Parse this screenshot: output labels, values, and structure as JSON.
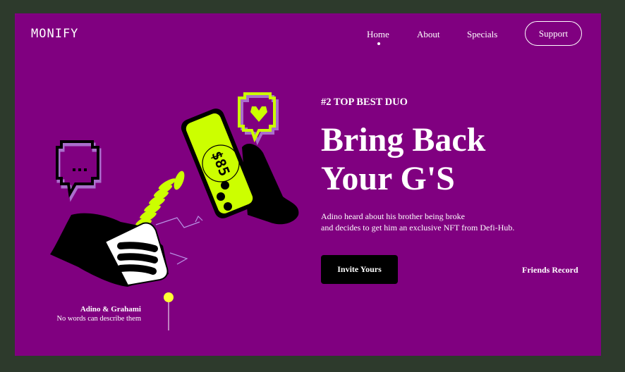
{
  "brand": {
    "logo": "MONIFY"
  },
  "nav": {
    "items": [
      {
        "label": "Home",
        "active": true
      },
      {
        "label": "About"
      },
      {
        "label": "Specials"
      }
    ],
    "support_label": "Support"
  },
  "hero": {
    "eyebrow": "#2 TOP BEST DUO",
    "headline_line1": "Bring Back",
    "headline_line2": "Your G'S",
    "description_line1": "Adino heard about his brother being broke",
    "description_line2": "and decides to get him an exclusive NFT from Defi-Hub.",
    "cta_label": "Invite Yours",
    "secondary_link": "Friends Record"
  },
  "illustration": {
    "phone_screen_text": "$85",
    "caption_name": "Adino & Grahami",
    "caption_sub": "No words can describe them"
  },
  "colors": {
    "page_background": "#2d3a2c",
    "frame_background": "#800080",
    "accent": "#ccff00",
    "text": "#ffffff",
    "button": "#000000"
  }
}
